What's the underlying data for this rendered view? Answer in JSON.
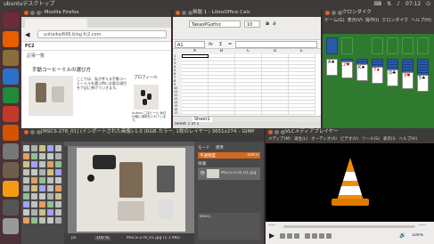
{
  "top_panel": {
    "title": "ubuntuデスクトップ",
    "time": "07:12"
  },
  "launcher": {
    "items": [
      {
        "name": "dash-home",
        "color": "#6b2d3a"
      },
      {
        "name": "firefox",
        "color": "#e66000"
      },
      {
        "name": "files",
        "color": "#8a6d3b"
      },
      {
        "name": "libreoffice-writer",
        "color": "#2a72c7"
      },
      {
        "name": "libreoffice-calc",
        "color": "#1f8a3a"
      },
      {
        "name": "libreoffice-impress",
        "color": "#c0392b"
      },
      {
        "name": "software-center",
        "color": "#d35400"
      },
      {
        "name": "settings",
        "color": "#777"
      },
      {
        "name": "gimp",
        "color": "#6d5f4b"
      },
      {
        "name": "vlc",
        "color": "#f39c12"
      },
      {
        "name": "games",
        "color": "#555"
      },
      {
        "name": "trash",
        "color": "#999"
      }
    ]
  },
  "firefox": {
    "title": "- Mozilla Firefox",
    "url": "yuhaikai666.blog.fc2.com",
    "site_title": "FC2",
    "section": "記事一覧",
    "post_title": "手動コーヒーミルの選び方",
    "post_text": "ここでは、私が考える手動コーヒーミルを選ぶ時に必要な項目を下記に挙げていきます。",
    "profile_heading": "プロフィール",
    "profile_text": "Author:ごぼビール 休日の朝に珈琲をいれています。"
  },
  "calc": {
    "title": "無題 1 - LibreOffice Calc",
    "font_name": "TakaoPGothic",
    "font_size": "10",
    "cell_ref": "A1",
    "formula_btn": "fx",
    "sum_btn": "Σ",
    "eq_btn": "=",
    "col_headers": [
      "A",
      "B",
      "C",
      "D",
      "E"
    ],
    "row_headers": [
      "1",
      "2",
      "3",
      "4",
      "5",
      "6",
      "7",
      "8",
      "9",
      "10",
      "11",
      "12",
      "13",
      "14",
      "15",
      "16",
      "17",
      "18",
      "19",
      "20",
      "21"
    ],
    "sheet_tab": "Sheet1",
    "status": "Sheet 1 of 1",
    "zoom": "100%"
  },
  "solitaire": {
    "title": "クロンダイク",
    "menu": [
      "ゲーム(G)",
      "表示(V)",
      "操作(I)",
      "クロンダイク",
      "ヘルプ(H)"
    ],
    "columns": [
      {
        "backs": 0,
        "face": "A♠",
        "color": "blk"
      },
      {
        "backs": 1,
        "face": "2♥",
        "color": "red"
      },
      {
        "backs": 2,
        "face": "K♠",
        "color": "blk"
      },
      {
        "backs": 3,
        "face": "7♦",
        "color": "red"
      },
      {
        "backs": 4,
        "face": "Q♣",
        "color": "blk"
      },
      {
        "backs": 5,
        "face": "9♥",
        "color": "red"
      },
      {
        "backs": 6,
        "face": "5♠",
        "color": "blk"
      }
    ]
  },
  "gimp": {
    "title": "[MSCS-278_01] (インポートされた画像)-1.0 (RGB カラー, 1枚のレイヤー) 3651x274 – GIMP",
    "zoom": "100 %",
    "status": "MSCS-278_01.jpg (1.1 MB)",
    "layers_mode_label": "モード",
    "layers_mode": "標準",
    "opacity_label": "不透明度",
    "opacity": "100.0",
    "lock_label": "保護:",
    "layer_name": "MSCS-278_01.jpg",
    "brush_label": "Basic,",
    "units": "px"
  },
  "vlc": {
    "title": "VLCメディアプレイヤー",
    "menu": [
      "メディア(M)",
      "再生(L)",
      "オーディオ(A)",
      "ビデオ(V)",
      "ツール(S)",
      "表示(I)",
      "ヘルプ(H)"
    ],
    "time_left": "--:--",
    "time_right": "--:--",
    "volume": "100%"
  }
}
